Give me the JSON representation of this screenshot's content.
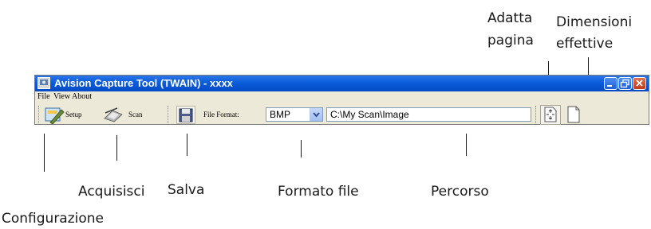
{
  "window": {
    "title": "Avision Capture Tool (TWAIN) - xxxx",
    "buttons": [
      "minimize",
      "restore",
      "close"
    ]
  },
  "menubar": {
    "items": [
      "File",
      "View",
      "About"
    ]
  },
  "toolbar": {
    "setup_label": "Setup",
    "scan_label": "Scan",
    "file_format_label": "File Format:",
    "file_format_value": "BMP",
    "path_value": "C:\\My Scan\\Image"
  },
  "callouts": {
    "fit_page": [
      "Adatta",
      "pagina"
    ],
    "actual_size": [
      "Dimensioni",
      "effettive"
    ],
    "setup": "Configurazione",
    "scan": "Acquisisci",
    "save": "Salva",
    "file_format": "Formato file",
    "path": "Percorso"
  },
  "colors": {
    "titlebar": "#0a5ddc",
    "window_bg": "#ece9d8",
    "close_button": "#c03a1a"
  }
}
